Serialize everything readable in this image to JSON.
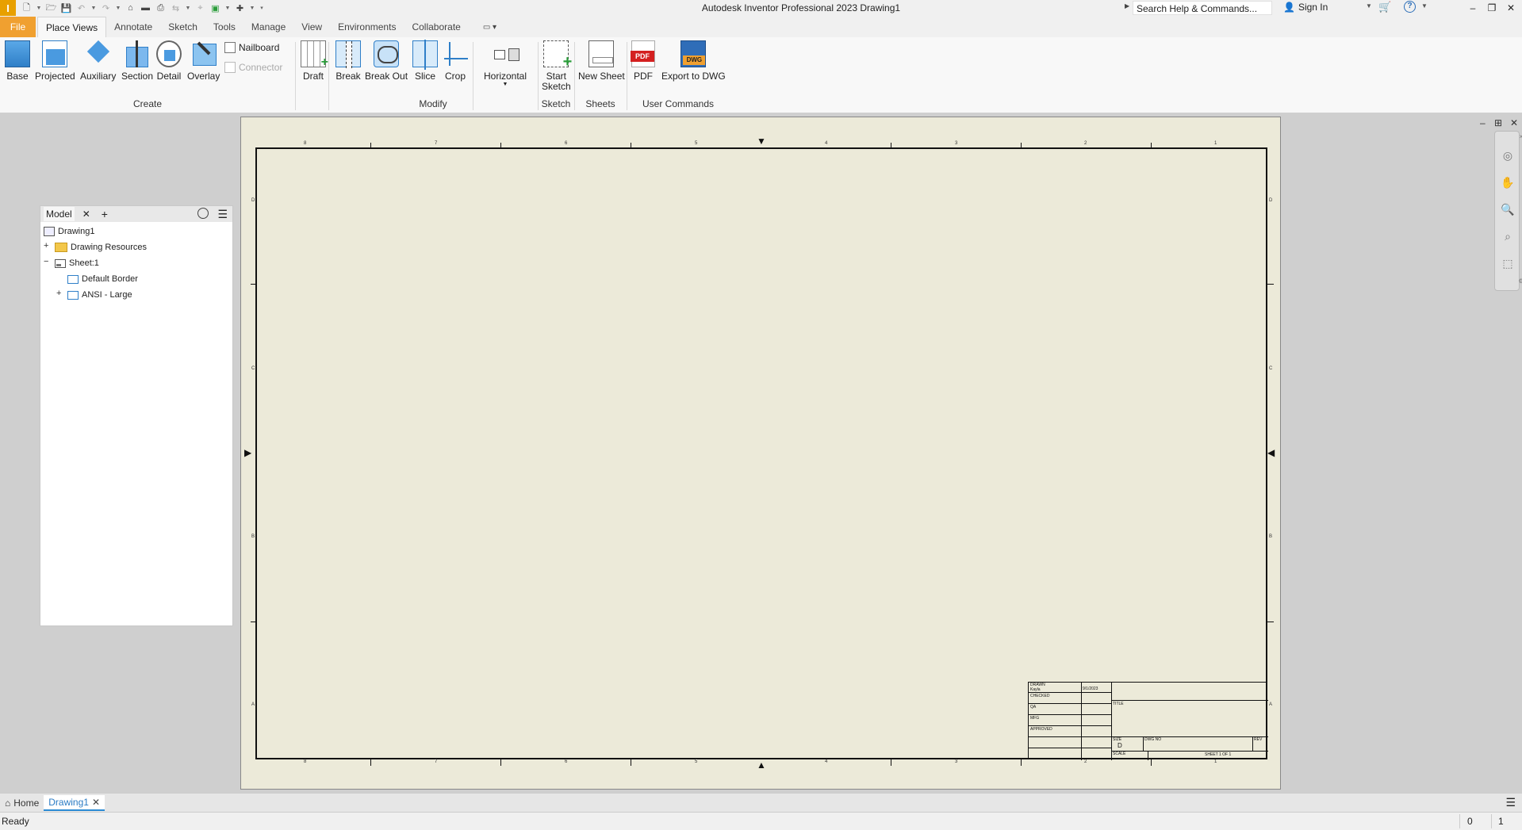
{
  "app": {
    "logo": "I",
    "title": "Autodesk Inventor Professional 2023   Drawing1"
  },
  "quick_access": [
    "new-icon",
    "open-icon",
    "save-icon",
    "undo-icon",
    "redo-icon",
    "home-icon",
    "return-icon",
    "print-icon",
    "update-icon",
    "select-icon",
    "appearance-icon",
    "measure-icon"
  ],
  "search": {
    "placeholder": "Search Help & Commands..."
  },
  "account": {
    "signin_label": "Sign In"
  },
  "tabs": [
    {
      "label": "File"
    },
    {
      "label": "Place Views"
    },
    {
      "label": "Annotate"
    },
    {
      "label": "Sketch"
    },
    {
      "label": "Tools"
    },
    {
      "label": "Manage"
    },
    {
      "label": "View"
    },
    {
      "label": "Environments"
    },
    {
      "label": "Collaborate"
    }
  ],
  "ribbon": {
    "create": {
      "label": "Create",
      "buttons": [
        "Base",
        "Projected",
        "Auxiliary",
        "Section",
        "Detail",
        "Overlay"
      ],
      "nailboard": "Nailboard",
      "connector": "Connector"
    },
    "modify": {
      "label": "Modify",
      "buttons": [
        "Draft",
        "Break",
        "Break Out",
        "Slice",
        "Crop"
      ],
      "horizontal": "Horizontal"
    },
    "sketch": {
      "label": "Sketch",
      "start_sketch_1": "Start",
      "start_sketch_2": "Sketch"
    },
    "sheets": {
      "label": "Sheets",
      "new_sheet": "New Sheet"
    },
    "user_commands": {
      "label": "User Commands",
      "pdf": "PDF",
      "export_dwg": "Export to DWG"
    }
  },
  "browser": {
    "tab_label": "Model",
    "tree": [
      {
        "label": "Drawing1"
      },
      {
        "label": "Drawing Resources"
      },
      {
        "label": "Sheet:1"
      },
      {
        "label": "Default Border"
      },
      {
        "label": "ANSI - Large"
      }
    ]
  },
  "sheet": {
    "zone_numbers": [
      "8",
      "7",
      "6",
      "5",
      "4",
      "3",
      "2",
      "1"
    ],
    "zone_letters": [
      "D",
      "C",
      "B",
      "A"
    ],
    "title_block": {
      "drawn": "DRAWN",
      "author": "Kayla ",
      "date": "9/1/2023",
      "checked": "CHECKED",
      "qa": "QA",
      "mfg": "MFG",
      "approved": "APPROVED",
      "title": "TITLE",
      "size_label": "SIZE",
      "size_value": "D",
      "dwg_no": "DWG NO",
      "rev": "REV",
      "scale": "SCALE",
      "sheet": "SHEET 1  OF 1"
    }
  },
  "doc_tabs": [
    {
      "label": "Home"
    },
    {
      "label": "Drawing1"
    }
  ],
  "status": {
    "text": "Ready",
    "num1": "0",
    "num2": "1"
  }
}
